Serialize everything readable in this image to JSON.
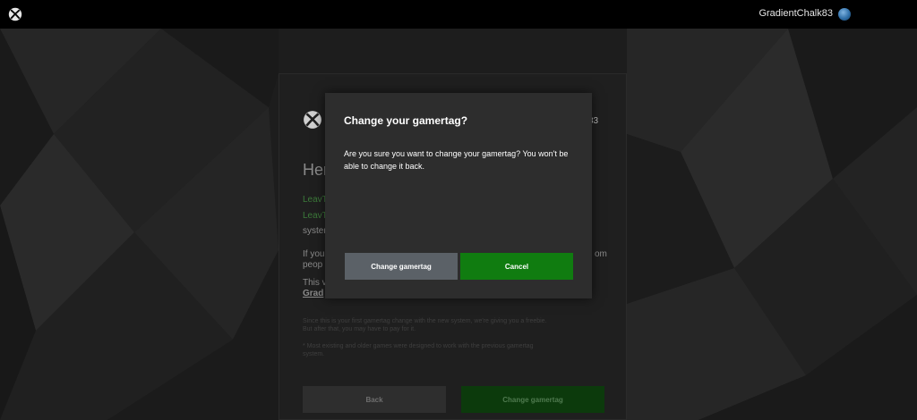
{
  "header": {
    "username": "GradientChalk83",
    "logo_icon": "xbox-logo-icon",
    "avatar_icon": "globe-avatar-icon"
  },
  "panel": {
    "gamertag_fragment": "k83",
    "heading_fragment": "Her",
    "green_line_1": "LeavT",
    "green_line_2": "LeavT",
    "line_system": "syster",
    "line_if": "If you",
    "line_peop": "peop",
    "line_this": "This v",
    "line_grad": "Grad",
    "line_om": "om",
    "fine_print_1a": "Since this is your first gamertag change with the new system, we're giving you a freebie.",
    "fine_print_1b": "But after that, you may have to pay for it.",
    "fine_print_2a": "* Most existing and older games were designed to work with the previous gamertag",
    "fine_print_2b": "system.",
    "back_label": "Back",
    "change_label": "Change gamertag"
  },
  "dialog": {
    "title": "Change your gamertag?",
    "message": "Are you sure you want to change your gamertag? You won't be able to change it back.",
    "confirm_label": "Change gamertag",
    "cancel_label": "Cancel"
  },
  "colors": {
    "accent_green": "#107c10",
    "dialog_bg": "#2d2d2d",
    "secondary_button": "#5b6167",
    "topbar": "#000000"
  }
}
